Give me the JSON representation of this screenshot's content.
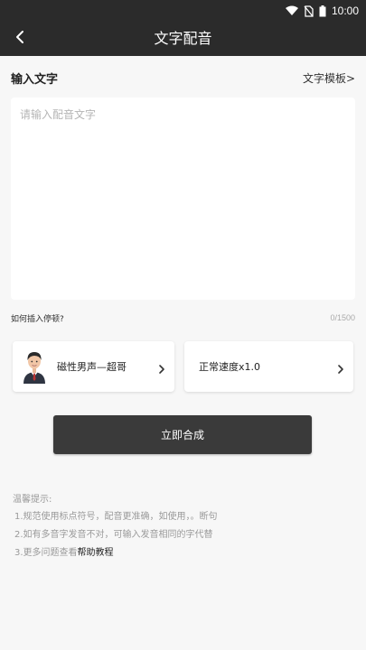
{
  "status_bar": {
    "time": "10:00",
    "icons": [
      "wifi-icon",
      "no-sim-icon",
      "battery-icon"
    ]
  },
  "app_bar": {
    "title": "文字配音",
    "back_icon": "back-arrow-icon"
  },
  "input_section": {
    "title": "输入文字",
    "template_link": "文字模板>",
    "placeholder": "请输入配音文字",
    "value": "",
    "pause_help": "如何插入停顿?",
    "char_count": "0/1500"
  },
  "voice_card": {
    "label": "磁性男声—超哥",
    "avatar": "male-voice-avatar"
  },
  "speed_card": {
    "label": "正常速度x1.0"
  },
  "synthesize_button": {
    "label": "立即合成"
  },
  "tips": {
    "title": "温馨提示:",
    "line1": "1.规范使用标点符号，配音更准确，如使用，。断句",
    "line2": "2.如有多音字发音不对，可输入发音相同的字代替",
    "line3_prefix": "3.更多问题查看",
    "line3_link": "帮助教程"
  },
  "colors": {
    "header_bg": "#2b2b2b",
    "page_bg": "#f7f7f7",
    "button_bg": "#3a3a3a",
    "tip_text": "#9a9a9a"
  }
}
